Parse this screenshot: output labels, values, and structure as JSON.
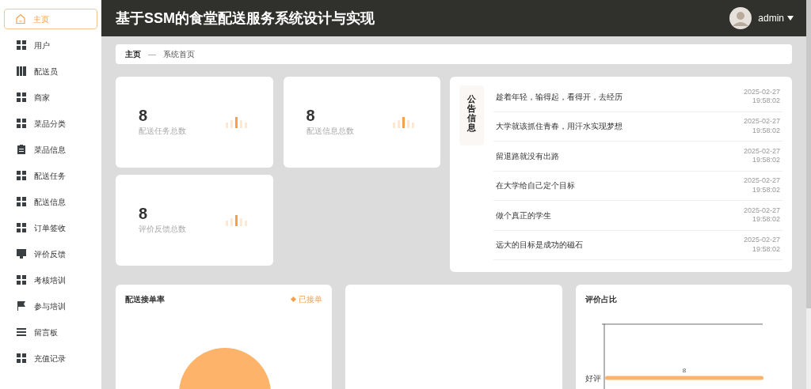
{
  "header": {
    "title": "基于SSM的食堂配送服务系统设计与实现",
    "user": "admin"
  },
  "sidebar": {
    "items": [
      {
        "label": "主页",
        "selected": true
      },
      {
        "label": "用户",
        "selected": false
      },
      {
        "label": "配送员",
        "selected": false
      },
      {
        "label": "商家",
        "selected": false
      },
      {
        "label": "菜品分类",
        "selected": false
      },
      {
        "label": "菜品信息",
        "selected": false
      },
      {
        "label": "配送任务",
        "selected": false
      },
      {
        "label": "配送信息",
        "selected": false
      },
      {
        "label": "订单签收",
        "selected": false
      },
      {
        "label": "评价反馈",
        "selected": false
      },
      {
        "label": "考核培训",
        "selected": false
      },
      {
        "label": "参与培训",
        "selected": false
      },
      {
        "label": "留言板",
        "selected": false
      },
      {
        "label": "充值记录",
        "selected": false
      }
    ]
  },
  "breadcrumb": {
    "current": "主页",
    "separator": "—",
    "page": "系统首页"
  },
  "stats": [
    {
      "value": "8",
      "label": "配送任务总数"
    },
    {
      "value": "8",
      "label": "配送信息总数"
    },
    {
      "value": "8",
      "label": "评价反馈总数"
    }
  ],
  "notices": {
    "title": "公告信息",
    "items": [
      {
        "text": "趁着年轻，输得起，看得开，去经历",
        "date": "2025-02-27",
        "time": "19:58:02"
      },
      {
        "text": "大学就该抓住青春，用汗水实现梦想",
        "date": "2025-02-27",
        "time": "19:58:02"
      },
      {
        "text": "留退路就没有出路",
        "date": "2025-02-27",
        "time": "19:58:02"
      },
      {
        "text": "在大学给自己定个目标",
        "date": "2025-02-27",
        "time": "19:58:02"
      },
      {
        "text": "做个真正的学生",
        "date": "2025-02-27",
        "time": "19:58:02"
      },
      {
        "text": "远大的目标是成功的磁石",
        "date": "2025-02-27",
        "time": "19:58:02"
      }
    ]
  },
  "charts": [
    {
      "title": "配送接单率",
      "legend": "已接单"
    },
    {
      "title": "评价占比",
      "chart_data": {
        "type": "bar",
        "orientation": "horizontal",
        "categories": [
          "好评"
        ],
        "values": [
          8
        ],
        "data_labels": true
      }
    }
  ]
}
